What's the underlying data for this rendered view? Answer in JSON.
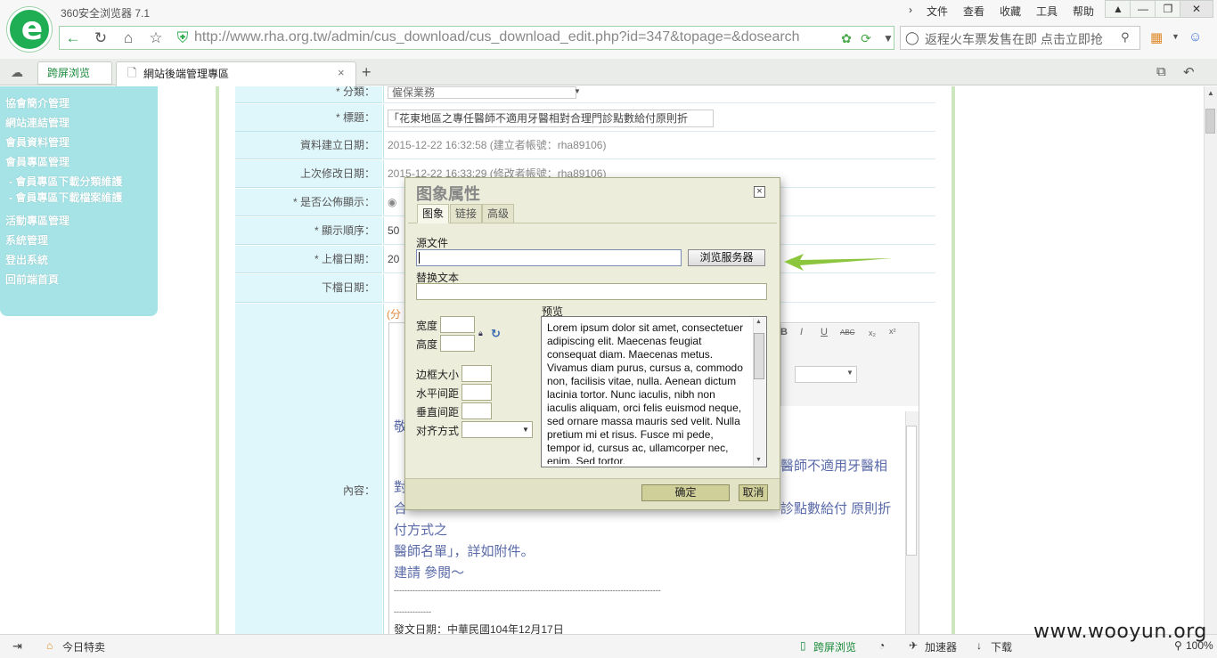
{
  "browser": {
    "title": "360安全浏览器 7.1",
    "menu": [
      "文件",
      "查看",
      "收藏",
      "工具",
      "帮助"
    ],
    "url": "http://www.rha.org.tw/admin/cus_download/cus_download_edit.php?id=347&topage=&dosearch",
    "search_text": "返程火车票发售在即 点击立即抢",
    "tabs": [
      {
        "label": "跨屏浏览"
      },
      {
        "label": "網站後端管理專區"
      }
    ]
  },
  "sidebar": {
    "items": [
      {
        "label": "協會簡介管理"
      },
      {
        "label": "網站連結管理"
      },
      {
        "label": "會員資料管理"
      },
      {
        "label": "會員專區管理"
      },
      {
        "label": "- 會員專區下載分類維護"
      },
      {
        "label": "- 會員專區下載檔案維護"
      },
      {
        "label": "活動專區管理"
      },
      {
        "label": "系統管理"
      },
      {
        "label": "登出系統"
      },
      {
        "label": "回前端首頁"
      }
    ]
  },
  "form": {
    "rows": [
      {
        "label": "* 分類：",
        "value": "僱保業務"
      },
      {
        "label": "* 標題：",
        "value": "「花東地區之專任醫師不適用牙醫相對合理門診點數給付原則折"
      },
      {
        "label": "資料建立日期：",
        "value": "2015-12-22 16:32:58 (建立者帳號：rha89106)"
      },
      {
        "label": "上次修改日期：",
        "value": "2015-12-22 16:33:29 (修改者帳號：rha89106)"
      },
      {
        "label": "* 是否公佈顯示：",
        "value": "◉"
      },
      {
        "label": "* 顯示順序：",
        "value": "50"
      },
      {
        "label": "* 上檔日期：",
        "value": "20"
      },
      {
        "label": "下檔日期：",
        "value": ""
      }
    ],
    "content_label": "內容：",
    "content_hint": "(分",
    "content_lines": [
      "敬",
      "醫師不適用牙醫相",
      "對",
      "合",
      "診點數給付 原則折",
      "付方式之",
      "醫師名單」，詳如附件。",
      "建請 參閱～",
      "----------------------------------------------------------------------------------------------------",
      "--------------",
      "發文日期：中華民國104年12月17日"
    ]
  },
  "dialog": {
    "title": "图象属性",
    "close": "⊠",
    "tabs": [
      "图象",
      "链接",
      "高级"
    ],
    "source_label": "源文件",
    "source_value": "",
    "browse_button": "浏览服务器",
    "alt_label": "替换文本",
    "alt_value": "",
    "width_label": "宽度",
    "height_label": "高度",
    "border_label": "边框大小",
    "hspace_label": "水平间距",
    "vspace_label": "垂直间距",
    "align_label": "对齐方式",
    "preview_label": "预览",
    "preview_text": "Lorem ipsum dolor sit amet, consectetuer adipiscing elit. Maecenas feugiat consequat diam. Maecenas metus. Vivamus diam purus, cursus a, commodo non, facilisis vitae, nulla. Aenean dictum lacinia tortor. Nunc iaculis, nibh non iaculis aliquam, orci felis euismod neque, sed ornare massa mauris sed velit. Nulla pretium mi et risus. Fusce mi pede, tempor id, cursus ac, ullamcorper nec, enim. Sed tortor.",
    "ok": "确定",
    "cancel": "取消"
  },
  "status": {
    "today": "今日特卖",
    "kuaping": "跨屏浏览",
    "accelerator": "加速器",
    "download": "下载",
    "zoom": "100%"
  },
  "watermark": "www.wooyun.org",
  "colors": {
    "sidebar": "#a6e3e6",
    "label_bg": "#dff6fb",
    "dialog_bg": "#ecedda",
    "arrow": "#8cc63f",
    "content_text": "#5a6aa8"
  }
}
